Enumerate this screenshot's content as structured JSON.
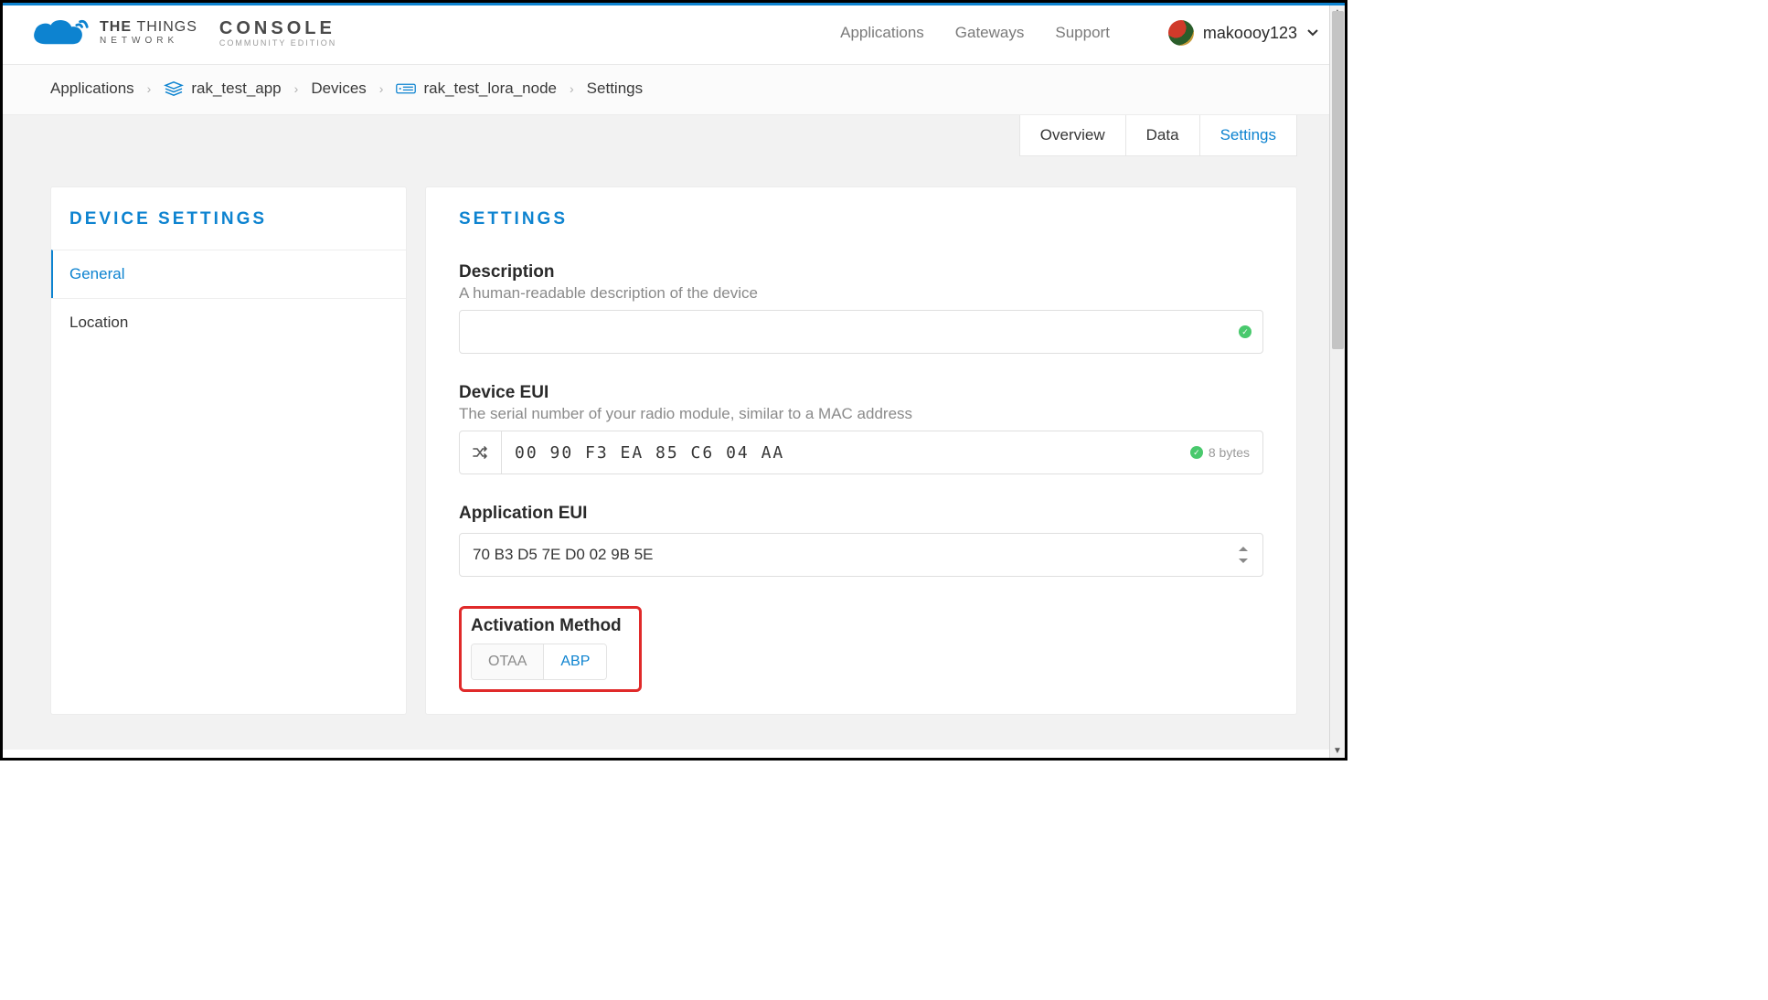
{
  "brand": {
    "line1_a": "THE",
    "line1_b": "THINGS",
    "line2": "NETWORK",
    "console": "CONSOLE",
    "edition": "COMMUNITY EDITION"
  },
  "nav": {
    "applications": "Applications",
    "gateways": "Gateways",
    "support": "Support"
  },
  "user": {
    "name": "makoooy123"
  },
  "breadcrumb": {
    "applications": "Applications",
    "app_id": "rak_test_app",
    "devices": "Devices",
    "device_id": "rak_test_lora_node",
    "settings": "Settings"
  },
  "tabs": {
    "overview": "Overview",
    "data": "Data",
    "settings": "Settings"
  },
  "sidebar": {
    "title": "DEVICE SETTINGS",
    "items": [
      "General",
      "Location"
    ]
  },
  "main": {
    "title": "SETTINGS",
    "description": {
      "label": "Description",
      "help": "A human-readable description of the device",
      "value": ""
    },
    "device_eui": {
      "label": "Device EUI",
      "help": "The serial number of your radio module, similar to a MAC address",
      "value": "00  90  F3  EA  85  C6  04  AA",
      "bytes": "8 bytes"
    },
    "app_eui": {
      "label": "Application EUI",
      "value": "70 B3 D5 7E D0 02 9B 5E"
    },
    "activation": {
      "label": "Activation Method",
      "options": [
        "OTAA",
        "ABP"
      ],
      "selected": "ABP"
    }
  }
}
